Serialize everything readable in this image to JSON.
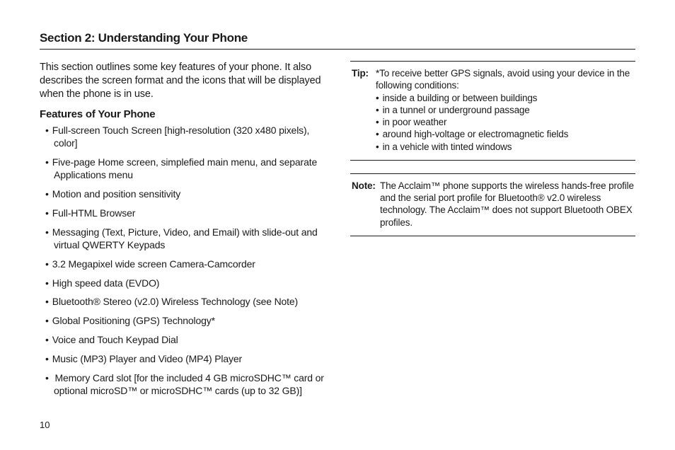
{
  "section_title": "Section 2: Understanding Your Phone",
  "intro": "This section outlines some key features of your phone. It also describes the screen format and the icons that will be displayed when the phone is in use.",
  "features_heading": "Features of Your Phone",
  "features": [
    "Full-screen Touch Screen [high-resolution (320 x480 pixels), color]",
    "Five-page Home screen, simplefied main menu, and separate Applications menu",
    "Motion and position sensitivity",
    "Full-HTML Browser",
    "Messaging (Text, Picture, Video, and Email) with slide-out and virtual QWERTY Keypads",
    "3.2 Megapixel wide screen Camera-Camcorder",
    "High speed data (EVDO)",
    "Bluetooth® Stereo (v2.0) Wireless Technology (see Note)",
    "Global Positioning (GPS) Technology*",
    "Voice and Touch Keypad Dial",
    "Music (MP3) Player and Video (MP4) Player",
    " Memory Card slot [for the included 4 GB microSDHC™ card or optional microSD™ or microSDHC™ cards (up to 32 GB)]"
  ],
  "tip": {
    "label": "Tip:",
    "lead": "*To receive better GPS signals, avoid using your device in the following conditions:",
    "items": [
      "inside a building or between buildings",
      "in a tunnel or underground passage",
      "in poor weather",
      "around high-voltage or electromagnetic fields",
      "in a vehicle with tinted windows"
    ]
  },
  "note": {
    "label": "Note:",
    "body": "The Acclaim™ phone supports the wireless hands-free profile and the serial port profile for Bluetooth® v2.0 wireless technology. The Acclaim™ does not support Bluetooth OBEX profiles."
  },
  "page_number": "10"
}
